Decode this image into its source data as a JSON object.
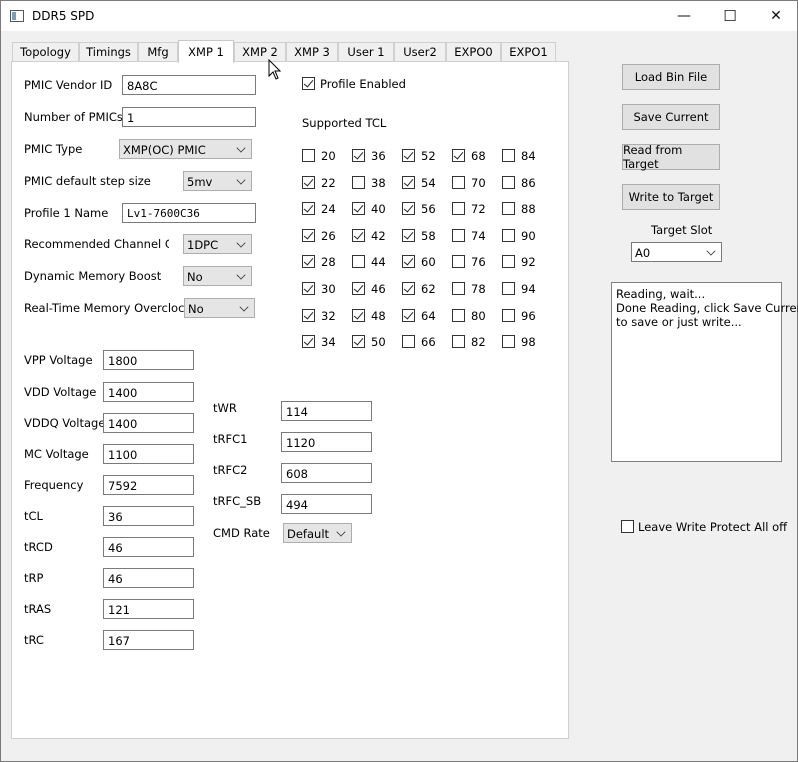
{
  "window": {
    "title": "DDR5 SPD",
    "minimize_glyph": "—",
    "maximize_glyph": "☐",
    "close_glyph": "✕"
  },
  "tabs": [
    {
      "label": "Topology"
    },
    {
      "label": "Timings"
    },
    {
      "label": "Mfg"
    },
    {
      "label": "XMP 1"
    },
    {
      "label": "XMP 2"
    },
    {
      "label": "XMP 3"
    },
    {
      "label": "User 1"
    },
    {
      "label": "User2"
    },
    {
      "label": "EXPO0"
    },
    {
      "label": "EXPO1"
    }
  ],
  "active_tab": "XMP 1",
  "xmp": {
    "pmic_vendor_id": {
      "label": "PMIC Vendor ID",
      "value": "8A8C"
    },
    "num_pmics": {
      "label": "Number of PMICs",
      "value": "1"
    },
    "pmic_type": {
      "label": "PMIC Type",
      "value": "XMP(OC) PMIC"
    },
    "pmic_step": {
      "label": "PMIC default step size",
      "value": "5mv"
    },
    "profile_name": {
      "label": "Profile 1 Name",
      "value": "Lv1-7600C36"
    },
    "channel_config": {
      "label": "Recommended Channel Config",
      "value": "1DPC"
    },
    "dyn_boost": {
      "label": "Dynamic Memory Boost",
      "value": "No"
    },
    "rt_oc": {
      "label": "Real-Time Memory Overclocking",
      "value": "No"
    },
    "profile_enabled": {
      "label": "Profile Enabled",
      "checked": true
    },
    "supported_tcl_title": "Supported TCL",
    "tcl": [
      {
        "n": "20",
        "c": false
      },
      {
        "n": "36",
        "c": true
      },
      {
        "n": "52",
        "c": true
      },
      {
        "n": "68",
        "c": true
      },
      {
        "n": "84",
        "c": false
      },
      {
        "n": "22",
        "c": true
      },
      {
        "n": "38",
        "c": false
      },
      {
        "n": "54",
        "c": true
      },
      {
        "n": "70",
        "c": false
      },
      {
        "n": "86",
        "c": false
      },
      {
        "n": "24",
        "c": true
      },
      {
        "n": "40",
        "c": true
      },
      {
        "n": "56",
        "c": true
      },
      {
        "n": "72",
        "c": false
      },
      {
        "n": "88",
        "c": false
      },
      {
        "n": "26",
        "c": true
      },
      {
        "n": "42",
        "c": true
      },
      {
        "n": "58",
        "c": true
      },
      {
        "n": "74",
        "c": false
      },
      {
        "n": "90",
        "c": false
      },
      {
        "n": "28",
        "c": true
      },
      {
        "n": "44",
        "c": false
      },
      {
        "n": "60",
        "c": true
      },
      {
        "n": "76",
        "c": false
      },
      {
        "n": "92",
        "c": false
      },
      {
        "n": "30",
        "c": true
      },
      {
        "n": "46",
        "c": true
      },
      {
        "n": "62",
        "c": true
      },
      {
        "n": "78",
        "c": false
      },
      {
        "n": "94",
        "c": false
      },
      {
        "n": "32",
        "c": true
      },
      {
        "n": "48",
        "c": true
      },
      {
        "n": "64",
        "c": true
      },
      {
        "n": "80",
        "c": false
      },
      {
        "n": "96",
        "c": false
      },
      {
        "n": "34",
        "c": true
      },
      {
        "n": "50",
        "c": true
      },
      {
        "n": "66",
        "c": false
      },
      {
        "n": "82",
        "c": false
      },
      {
        "n": "98",
        "c": false
      }
    ],
    "voltages": [
      {
        "label": "VPP Voltage",
        "value": "1800"
      },
      {
        "label": "VDD Voltage",
        "value": "1400"
      },
      {
        "label": "VDDQ Voltage",
        "value": "1400"
      },
      {
        "label": "MC Voltage",
        "value": "1100"
      },
      {
        "label": "Frequency",
        "value": "7592"
      },
      {
        "label": "tCL",
        "value": "36"
      },
      {
        "label": "tRCD",
        "value": "46"
      },
      {
        "label": "tRP",
        "value": "46"
      },
      {
        "label": "tRAS",
        "value": "121"
      },
      {
        "label": "tRC",
        "value": "167"
      }
    ],
    "timings": [
      {
        "label": "tWR",
        "value": "114"
      },
      {
        "label": "tRFC1",
        "value": "1120"
      },
      {
        "label": "tRFC2",
        "value": "608"
      },
      {
        "label": "tRFC_SB",
        "value": "494"
      }
    ],
    "cmd_rate": {
      "label": "CMD Rate",
      "value": "Default"
    }
  },
  "side": {
    "load_bin": "Load Bin File",
    "save_current": "Save Current",
    "read_target": "Read from Target",
    "write_target": "Write to Target",
    "target_slot_label": "Target Slot",
    "target_slot_value": "A0",
    "log_lines": [
      "Reading, wait...",
      "Done Reading, click Save Current",
      "to save or just write..."
    ],
    "write_protect": {
      "label": "Leave Write Protect All off",
      "checked": false
    }
  }
}
